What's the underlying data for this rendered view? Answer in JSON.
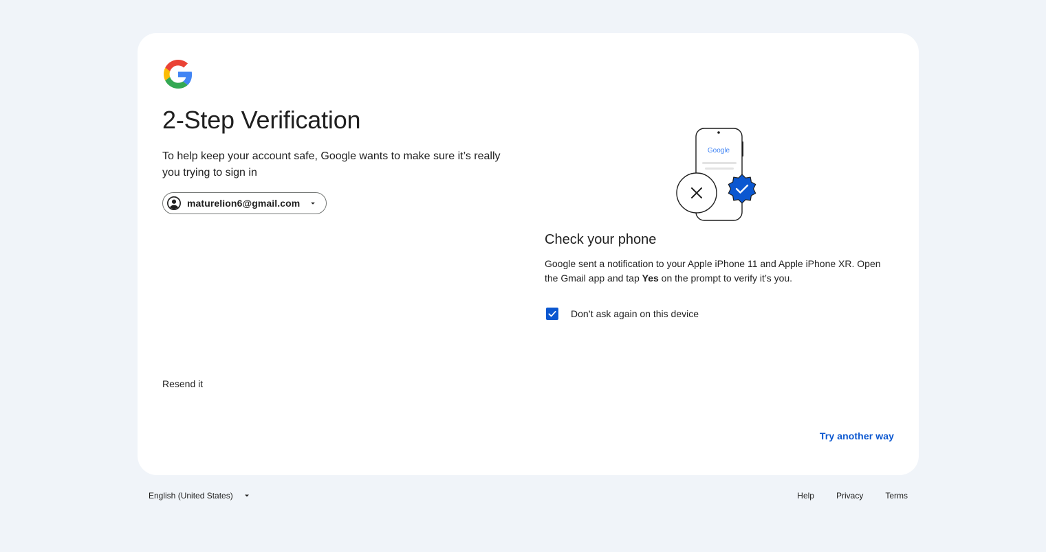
{
  "card": {
    "title": "2-Step Verification",
    "subtitle": "To help keep your account safe, Google wants to make sure it’s really you trying to sign in",
    "account_email": "maturelion6@gmail.com",
    "illustration": {
      "phone_brand": "Google"
    },
    "check_phone": {
      "title": "Check your phone",
      "body_before": "Google sent a notification to your Apple iPhone 11 and Apple iPhone XR. Open the Gmail app and tap ",
      "body_bold": "Yes",
      "body_after": " on the prompt to verify it’s you."
    },
    "dont_ask_again": {
      "label": "Don’t ask again on this device",
      "checked": true
    },
    "resend_label": "Resend it",
    "try_another_way_label": "Try another way"
  },
  "footer": {
    "language": "English (United States)",
    "links": {
      "help": "Help",
      "privacy": "Privacy",
      "terms": "Terms"
    }
  },
  "colors": {
    "background": "#f0f4f9",
    "card": "#ffffff",
    "accent": "#0b57d0",
    "text": "#1f1f1f"
  }
}
